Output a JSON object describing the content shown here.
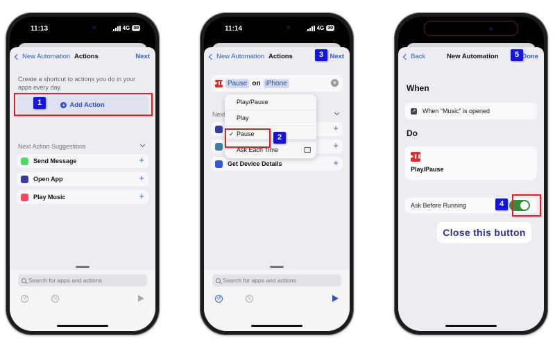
{
  "colors": {
    "accent_blue": "#2f5fc4",
    "badge_blue": "#1616d8",
    "highlight_red": "#d8232a",
    "toggle_green": "#3a8a3e",
    "media_red": "#d92b2b"
  },
  "screens": [
    {
      "status": {
        "time": "11:13",
        "network": "4G",
        "battery": "30"
      },
      "nav": {
        "back_label": "New Automation",
        "title": "Actions",
        "next_label": "Next"
      },
      "description": "Create a shortcut to actions you do in your apps every day.",
      "add_action_label": "Add Action",
      "badge": "1",
      "suggestions_header": "Next Action Suggestions",
      "suggestions": [
        {
          "label": "Send Message",
          "icon": "messages-icon",
          "color": "#4cd964"
        },
        {
          "label": "Open App",
          "icon": "open-app-icon",
          "color": "#3a3a9e"
        },
        {
          "label": "Play Music",
          "icon": "music-icon",
          "color": "#f0455a"
        }
      ],
      "search_placeholder": "Search for apps and actions"
    },
    {
      "status": {
        "time": "11:14",
        "network": "4G",
        "battery": "30"
      },
      "nav": {
        "back_label": "New Automation",
        "title": "Actions",
        "next_label": "Next"
      },
      "badge_next": "3",
      "badge_pause": "2",
      "action": {
        "verb": "Pause",
        "on_label": "on",
        "device": "iPhone"
      },
      "menu": [
        {
          "label": "Play/Pause",
          "checked": false
        },
        {
          "label": "Play",
          "checked": false
        },
        {
          "label": "Pause",
          "checked": true
        },
        {
          "label": "Ask Each Time",
          "checked": false
        }
      ],
      "check_glyph": "✓",
      "suggestions_header_partial": "Next",
      "suggestions": [
        {
          "label": "",
          "icon": "focus-moon-icon",
          "color": "#3a3a9e"
        },
        {
          "label": "",
          "icon": "display-icon",
          "color": "#3d7fa8"
        },
        {
          "label": "Get Device Details",
          "icon": "device-icon",
          "color": "#2e5ad8"
        }
      ],
      "search_placeholder": "Search for apps and actions"
    },
    {
      "nav": {
        "back_label": "Back",
        "title": "New Automation",
        "done_label": "Done"
      },
      "badge_done": "5",
      "badge_toggle": "4",
      "when_header": "When",
      "when_text": "When “Music” is opened",
      "do_header": "Do",
      "do_action": "Play/Pause",
      "ask_before_running_label": "Ask Before Running",
      "ask_before_running_on": true,
      "annotation": "Close this button"
    }
  ]
}
